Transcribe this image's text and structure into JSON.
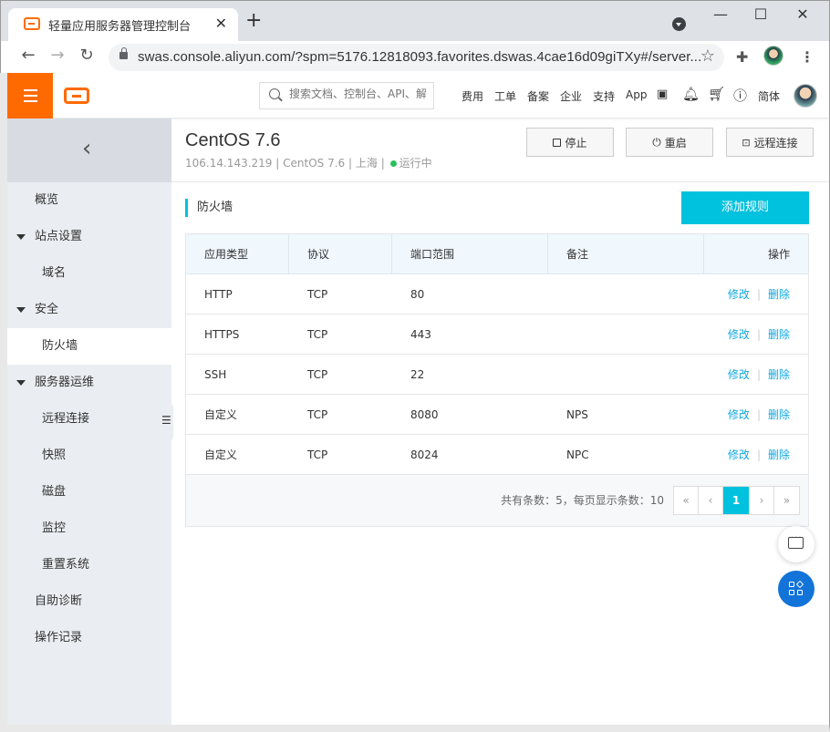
{
  "browser": {
    "tab_title": "轻量应用服务器管理控制台",
    "tab_close": "✕",
    "new_tab": "+",
    "url": "swas.console.aliyun.com/?spm=5176.12818093.favorites.dswas.4cae16d09giTXy#/server...",
    "win_min": "—",
    "win_max": "☐",
    "win_close": "✕"
  },
  "topbar": {
    "search_placeholder": "搜索文档、控制台、API、解",
    "nav": [
      "费用",
      "工单",
      "备案",
      "企业",
      "支持",
      "App"
    ],
    "lang": "简体"
  },
  "sidebar": {
    "items": [
      {
        "label": "概览"
      },
      {
        "label": "站点设置"
      },
      {
        "label": "域名"
      },
      {
        "label": "安全"
      },
      {
        "label": "防火墙"
      },
      {
        "label": "服务器运维"
      },
      {
        "label": "远程连接"
      },
      {
        "label": "快照"
      },
      {
        "label": "磁盘"
      },
      {
        "label": "监控"
      },
      {
        "label": "重置系统"
      },
      {
        "label": "自助诊断"
      },
      {
        "label": "操作记录"
      }
    ]
  },
  "instance": {
    "name": "CentOS 7.6",
    "ip": "106.14.143.219",
    "os": "CentOS 7.6",
    "region": "上海",
    "status": "运行中",
    "sep": "|"
  },
  "actions": {
    "stop": "停止",
    "restart": "重启",
    "remote": "远程连接"
  },
  "firewall": {
    "title": "防火墙",
    "add_rule": "添加规则",
    "columns": [
      "应用类型",
      "协议",
      "端口范围",
      "备注",
      "操作"
    ],
    "rows": [
      {
        "type": "HTTP",
        "protocol": "TCP",
        "port": "80",
        "note": ""
      },
      {
        "type": "HTTPS",
        "protocol": "TCP",
        "port": "443",
        "note": ""
      },
      {
        "type": "SSH",
        "protocol": "TCP",
        "port": "22",
        "note": ""
      },
      {
        "type": "自定义",
        "protocol": "TCP",
        "port": "8080",
        "note": "NPS"
      },
      {
        "type": "自定义",
        "protocol": "TCP",
        "port": "8024",
        "note": "NPC"
      }
    ],
    "edit": "修改",
    "delete": "删除",
    "op_sep": "|",
    "total_text": "共有条数：5，每页显示条数：10",
    "pager": {
      "first": "«",
      "prev": "‹",
      "current": "1",
      "next": "›",
      "last": "»"
    }
  }
}
